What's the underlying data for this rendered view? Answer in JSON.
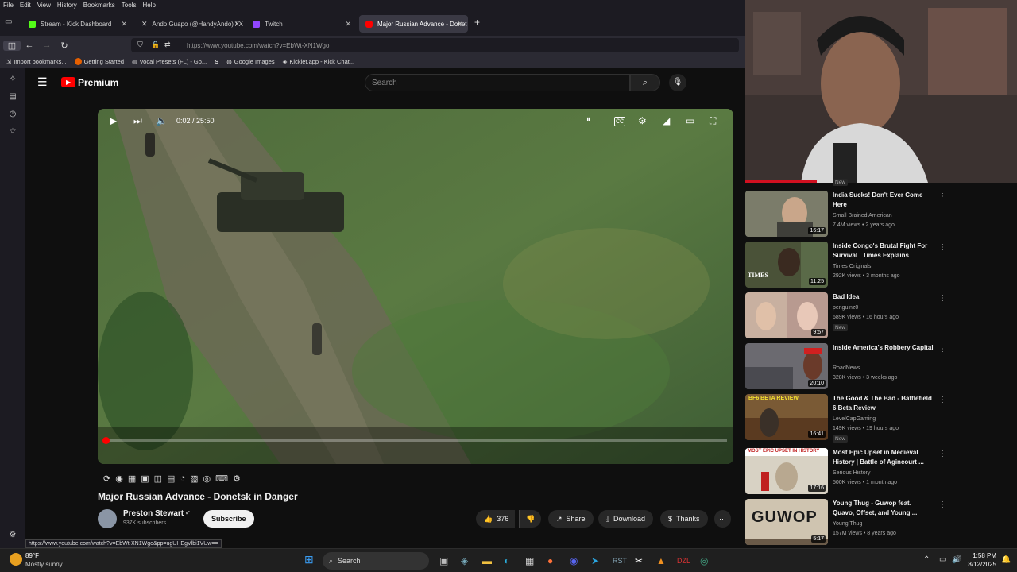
{
  "menubar": [
    "File",
    "Edit",
    "View",
    "History",
    "Bookmarks",
    "Tools",
    "Help"
  ],
  "tabs": [
    {
      "label": "Stream - Kick Dashboard",
      "color": "#53fc18"
    },
    {
      "label": "Ando Guapo (@HandyAndo) / X",
      "color": "#ffffff"
    },
    {
      "label": "Twitch",
      "color": "#9146ff"
    },
    {
      "label": "Major Russian Advance - Donet",
      "color": "#ff0000",
      "active": true
    }
  ],
  "url": "https://www.youtube.com/watch?v=EbWt-XN1Wgo",
  "bookmarks": [
    "Import bookmarks...",
    "Getting Started",
    "Vocal Presets (FL) - Go...",
    "Google Images",
    "Kicklet.app - Kick Chat..."
  ],
  "yt": {
    "brand": "Premium",
    "search_placeholder": "Search"
  },
  "player": {
    "time": "0:02 / 25:50",
    "progress_fraction": 0.002
  },
  "video": {
    "title": "Major Russian Advance - Donetsk in Danger",
    "channel": "Preston Stewart",
    "subscribers": "937K subscribers",
    "subscribe_label": "Subscribe",
    "likes": "376",
    "share_label": "Share",
    "download_label": "Download",
    "thanks_label": "Thanks"
  },
  "status_url": "https://www.youtube.com/watch?v=EbWt-XN1Wgo&pp=ugUHEgVlbi1VUw==",
  "related_top_badge": "New",
  "related": [
    {
      "title": "India Sucks! Don't Ever Come Here",
      "channel": "Small Brained American",
      "meta": "7.4M views • 2 years ago",
      "duration": "16:17",
      "badge": "",
      "thumb": "#6a6f63"
    },
    {
      "title": "Inside Congo's Brutal Fight For Survival | Times Explains",
      "channel": "Times Originals",
      "meta": "292K views • 3 months ago",
      "duration": "11:25",
      "badge": "",
      "thumb": "#4a5238"
    },
    {
      "title": "Bad Idea",
      "channel": "penguinz0",
      "meta": "689K views • 16 hours ago",
      "duration": "9:57",
      "badge": "New",
      "thumb": "#b59a8a"
    },
    {
      "title": "Inside America's Robbery Capital",
      "channel": "RoadNews",
      "meta": "328K views • 3 weeks ago",
      "duration": "20:10",
      "badge": "",
      "thumb": "#6b6a70"
    },
    {
      "title": "The Good & The Bad - Battlefield 6 Beta Review",
      "channel": "LevelCapGaming",
      "meta": "149K views • 19 hours ago",
      "duration": "16:41",
      "badge": "New",
      "thumb": "#7a5a35"
    },
    {
      "title": "Most Epic Upset in Medieval History | Battle of Agincourt ...",
      "channel": "Serious History",
      "meta": "500K views • 1 month ago",
      "duration": "17:16",
      "badge": "",
      "thumb": "#d8d2c4"
    },
    {
      "title": "Young Thug - Guwop feat. Quavo, Offset, and Young ...",
      "channel": "Young Thug",
      "meta": "157M views • 8 years ago",
      "duration": "5:17",
      "badge": "",
      "thumb": "#9a8f80"
    }
  ],
  "thumb_text": {
    "times": "TIMES",
    "bf6": "BF6 BETA REVIEW",
    "epic": "MOST EPIC UPSET IN HISTORY",
    "guwop": "GUWOP"
  },
  "taskbar": {
    "weather_temp": "89°F",
    "weather_desc": "Mostly sunny",
    "search_label": "Search",
    "time": "1:58 PM",
    "date": "8/12/2025"
  }
}
